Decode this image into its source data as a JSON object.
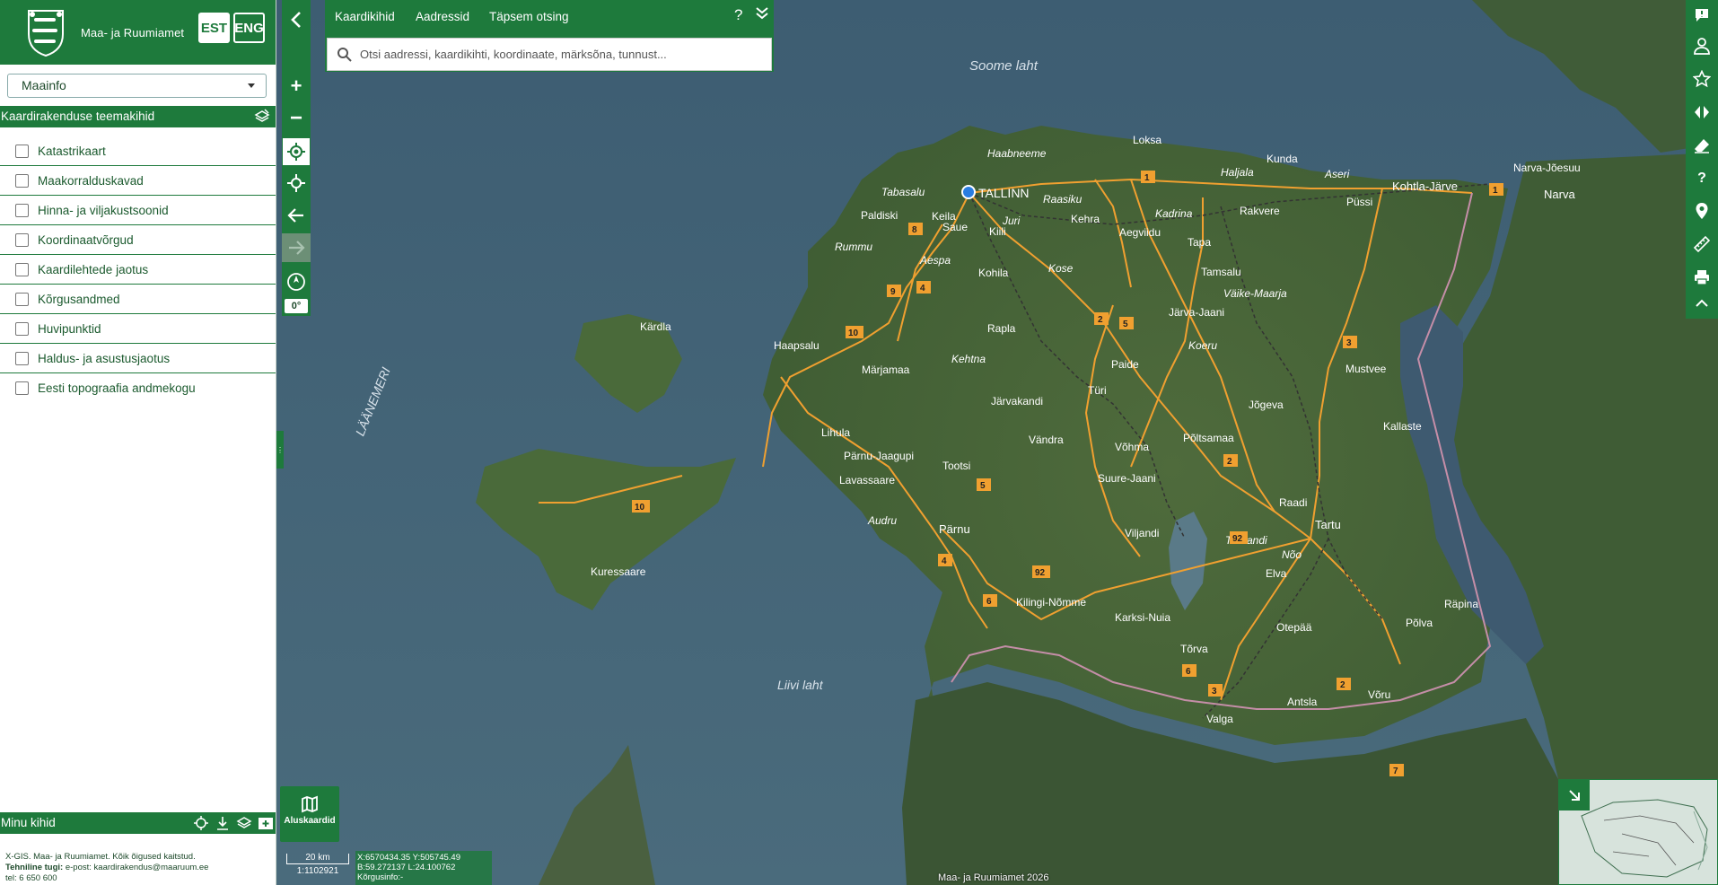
{
  "header": {
    "brand_name": "Maa- ja Ruumiamet",
    "lang_est": "EST",
    "lang_eng": "ENG"
  },
  "panel": {
    "theme_select": "Maainfo",
    "layers_title": "Kaardirakenduse teemakihid",
    "layers": [
      {
        "label": "Katastrikaart"
      },
      {
        "label": "Maakorralduskavad"
      },
      {
        "label": "Hinna- ja viljakustsoonid"
      },
      {
        "label": "Koordinaatvõrgud"
      },
      {
        "label": "Kaardilehtede jaotus"
      },
      {
        "label": "Kõrgusandmed"
      },
      {
        "label": "Huvipunktid"
      },
      {
        "label": "Haldus- ja asustusjaotus"
      },
      {
        "label": "Eesti topograafia andmekogu"
      }
    ],
    "my_layers_title": "Minu kihid",
    "footer_line1": "X-GIS. Maa- ja Ruumiamet. Kõik õigused kaitstud.",
    "footer_support_label": "Tehniline tugi:",
    "footer_support_email": " e-post: kaardirakendus@maaruum.ee",
    "footer_phone": "tel: 6 650 600"
  },
  "search": {
    "tabs": [
      "Kaardikihid",
      "Aadressid",
      "Täpsem otsing"
    ],
    "help": "?",
    "placeholder": "Otsi aadressi, kaardikihti, koordinaate, märksõna, tunnust..."
  },
  "toolbar": {
    "rotation": "0°"
  },
  "basemap": {
    "label": "Aluskaardid"
  },
  "status": {
    "scale_label": "20 km",
    "scale_ratio": "1:1102921",
    "coord_xy": "X:6570434.35 Y:505745.49",
    "coord_bl": "B:59.272137 L:24.100762",
    "elevation": "Kõrgusinfo:-",
    "copyright": "Maa- ja Ruumiamet 2026"
  },
  "map": {
    "water_labels": [
      "Soome laht",
      "LÄÄNEMERI",
      "Liivi laht"
    ],
    "places": [
      {
        "name": "TALLINN"
      },
      {
        "name": "Loksa"
      },
      {
        "name": "Kunda"
      },
      {
        "name": "Haabneeme"
      },
      {
        "name": "Tabasalu"
      },
      {
        "name": "Paldiski"
      },
      {
        "name": "Saue"
      },
      {
        "name": "Keila"
      },
      {
        "name": "Rummu"
      },
      {
        "name": "Kiili"
      },
      {
        "name": "Juri"
      },
      {
        "name": "Raasiku"
      },
      {
        "name": "Kehra"
      },
      {
        "name": "Haljala"
      },
      {
        "name": "Aseri"
      },
      {
        "name": "Kohtla-Järve"
      },
      {
        "name": "Narva-Jõesuu"
      },
      {
        "name": "Narva"
      },
      {
        "name": "Püssi"
      },
      {
        "name": "Rakvere"
      },
      {
        "name": "Kadrina"
      },
      {
        "name": "Aegviidu"
      },
      {
        "name": "Tapa"
      },
      {
        "name": "Tamsalu"
      },
      {
        "name": "Aespa"
      },
      {
        "name": "Kohila"
      },
      {
        "name": "Kose"
      },
      {
        "name": "Väike-Maarja"
      },
      {
        "name": "Kärdla"
      },
      {
        "name": "Haapsalu"
      },
      {
        "name": "Rapla"
      },
      {
        "name": "Järva-Jaani"
      },
      {
        "name": "Märjamaa"
      },
      {
        "name": "Kehtna"
      },
      {
        "name": "Paide"
      },
      {
        "name": "Koeru"
      },
      {
        "name": "Mustvee"
      },
      {
        "name": "Türi"
      },
      {
        "name": "Järvakandi"
      },
      {
        "name": "Jõgeva"
      },
      {
        "name": "Lihula"
      },
      {
        "name": "Vändra"
      },
      {
        "name": "Põltsamaa"
      },
      {
        "name": "Kallaste"
      },
      {
        "name": "Pärnu-Jaagupi"
      },
      {
        "name": "Võhma"
      },
      {
        "name": "Tootsi"
      },
      {
        "name": "Lavassaare"
      },
      {
        "name": "Suure-Jaani"
      },
      {
        "name": "Raadi"
      },
      {
        "name": "Tartu"
      },
      {
        "name": "Audru"
      },
      {
        "name": "Pärnu"
      },
      {
        "name": "Viljandi"
      },
      {
        "name": "Tõrvandi"
      },
      {
        "name": "Nõo"
      },
      {
        "name": "Elva"
      },
      {
        "name": "Kuressaare"
      },
      {
        "name": "Kilingi-Nõmme"
      },
      {
        "name": "Räpina"
      },
      {
        "name": "Karksi-Nuia"
      },
      {
        "name": "Otepää"
      },
      {
        "name": "Põlva"
      },
      {
        "name": "Tõrva"
      },
      {
        "name": "Antsla"
      },
      {
        "name": "Võru"
      },
      {
        "name": "Valga"
      }
    ],
    "roads": [
      "1",
      "8",
      "9",
      "4",
      "2",
      "5",
      "3",
      "10",
      "5",
      "2",
      "10",
      "92",
      "4",
      "92",
      "6",
      "6",
      "3",
      "2",
      "7",
      "1"
    ]
  },
  "colors": {
    "brand_green": "#1e7a3c",
    "road_orange": "#f0a030"
  }
}
